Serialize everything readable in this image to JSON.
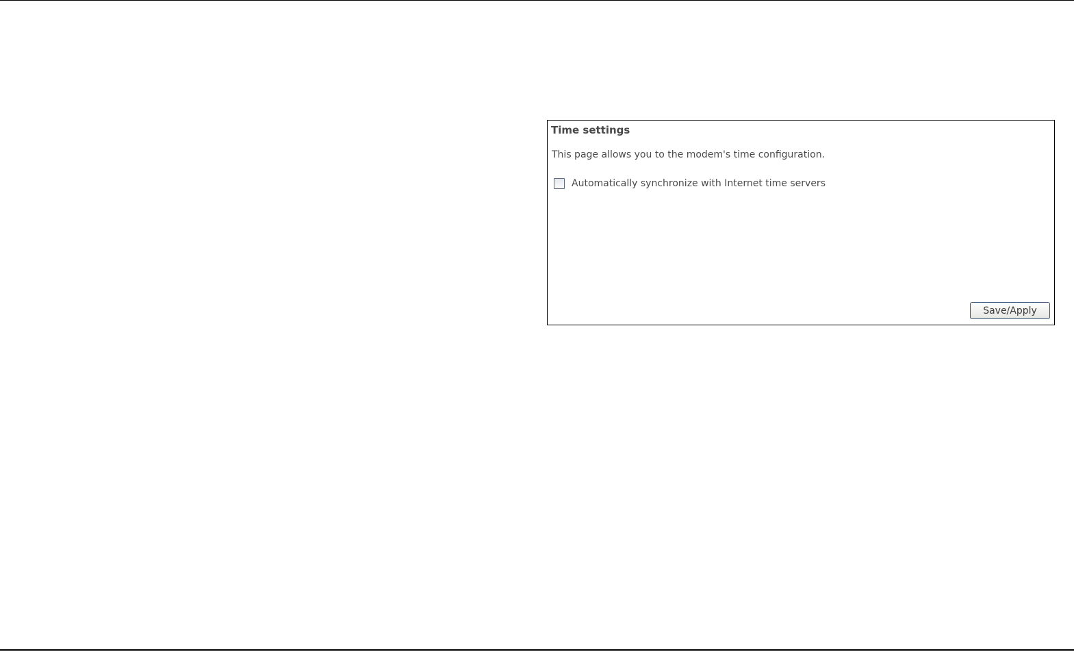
{
  "time_settings": {
    "title": "Time settings",
    "description": "This page allows you to the modem's time configuration.",
    "auto_sync": {
      "label": "Automatically synchronize with Internet time servers",
      "checked": false
    },
    "save_label": "Save/Apply"
  },
  "colors": {
    "text": "#4a4a4a",
    "panel_border": "#000000",
    "button_border": "#3e5a7a",
    "checkbox_border": "#5b6a7e"
  }
}
